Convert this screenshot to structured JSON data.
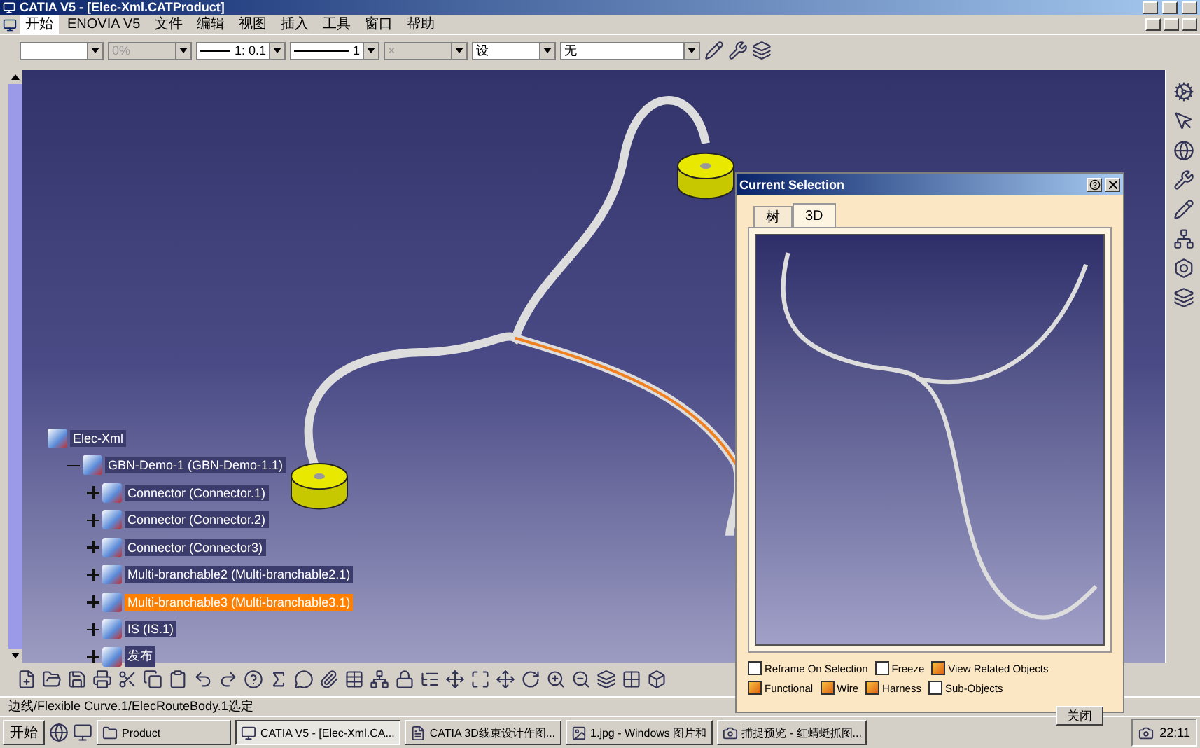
{
  "window": {
    "title": "CATIA V5 - [Elec-Xml.CATProduct]"
  },
  "menu": [
    {
      "label": "开始",
      "selected": true
    },
    {
      "label": "ENOVIA V5",
      "selected": false
    },
    {
      "label": "文件",
      "selected": false
    },
    {
      "label": "编辑",
      "selected": false
    },
    {
      "label": "视图",
      "selected": false
    },
    {
      "label": "插入",
      "selected": false
    },
    {
      "label": "工具",
      "selected": false
    },
    {
      "label": "窗口",
      "selected": false
    },
    {
      "label": "帮助",
      "selected": false
    }
  ],
  "toolbar": {
    "combos": [
      {
        "disabled": false,
        "kind": "plain"
      },
      {
        "value": "0%",
        "disabled": true,
        "kind": "plain"
      },
      {
        "value": "1: 0.1",
        "disabled": false,
        "kind": "line"
      },
      {
        "value": "1",
        "disabled": false,
        "kind": "line"
      },
      {
        "value": "×",
        "disabled": true,
        "kind": "plain"
      },
      {
        "value": "设",
        "disabled": false,
        "kind": "plain"
      },
      {
        "value": "无",
        "disabled": false,
        "kind": "wide"
      }
    ]
  },
  "tree": {
    "label": "Elec-Xml",
    "children": [
      {
        "label": "GBN-Demo-1 (GBN-Demo-1.1)",
        "expanded": true,
        "selected": false,
        "children": [
          {
            "label": "Connector (Connector.1)",
            "expanded": false,
            "selected": false
          },
          {
            "label": "Connector (Connector.2)",
            "expanded": false,
            "selected": false
          },
          {
            "label": "Connector (Connector3)",
            "expanded": false,
            "selected": false
          },
          {
            "label": "Multi-branchable2 (Multi-branchable2.1)",
            "expanded": false,
            "selected": false
          },
          {
            "label": "Multi-branchable3 (Multi-branchable3.1)",
            "expanded": false,
            "selected": true
          },
          {
            "label": "IS (IS.1)",
            "expanded": false,
            "selected": false
          },
          {
            "label": "发布",
            "expanded": false,
            "selected": false
          }
        ]
      }
    ]
  },
  "dialog": {
    "title": "Current Selection",
    "tabs": [
      {
        "label": "树",
        "selected": false
      },
      {
        "label": "3D",
        "selected": true
      }
    ],
    "options": [
      {
        "label": "Reframe On Selection",
        "checked": false
      },
      {
        "label": "Freeze",
        "checked": false
      },
      {
        "label": "View Related Objects",
        "checked": true
      },
      {
        "label": "Functional",
        "checked": true
      },
      {
        "label": "Wire",
        "checked": true
      },
      {
        "label": "Harness",
        "checked": true
      },
      {
        "label": "Sub-Objects",
        "checked": false
      }
    ],
    "button": "关闭"
  },
  "status_bar": {
    "text": "边线/Flexible Curve.1/ElecRouteBody.1选定"
  },
  "taskbar": {
    "start": "开始",
    "items": [
      {
        "label": "Product",
        "kind": "folder",
        "selected": false
      },
      {
        "label": "CATIA V5 - [Elec-Xml.CA...",
        "kind": "app",
        "selected": true
      },
      {
        "label": "CATIA 3D线束设计作图...",
        "kind": "doc",
        "selected": false
      },
      {
        "label": "1.jpg - Windows 图片和",
        "kind": "image",
        "selected": false
      },
      {
        "label": "捕捉预览 - 红蜻蜓抓图...",
        "kind": "capture",
        "selected": false
      }
    ],
    "clock": "22:11"
  }
}
